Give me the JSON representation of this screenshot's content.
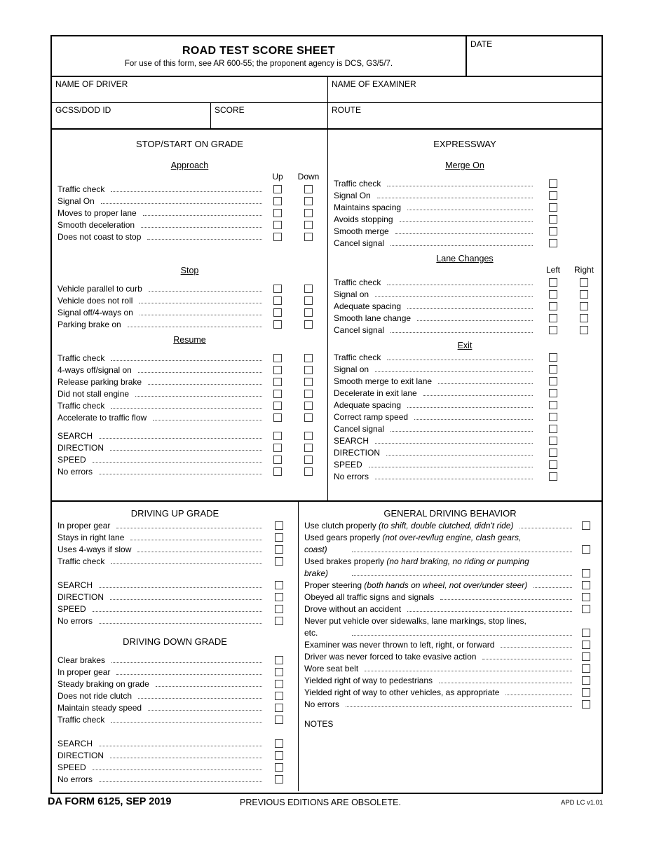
{
  "header": {
    "title": "ROAD TEST SCORE SHEET",
    "subtitle": "For use of this form, see AR 600-55; the proponent agency is DCS, G3/5/7.",
    "date_label": "DATE",
    "name_of_driver_label": "NAME OF DRIVER",
    "name_of_examiner_label": "NAME OF EXAMINER",
    "gcss_dod_id_label": "GCSS/DOD ID",
    "score_label": "SCORE",
    "route_label": "ROUTE"
  },
  "stop_start_on_grade": {
    "heading": "STOP/START ON GRADE",
    "col_up": "Up",
    "col_down": "Down",
    "approach": {
      "heading": "Approach",
      "items": [
        "Traffic check",
        "Signal On",
        "Moves to proper lane",
        "Smooth deceleration",
        "Does not coast to stop"
      ]
    },
    "stop": {
      "heading": "Stop",
      "items": [
        "Vehicle parallel to curb",
        "Vehicle does not roll",
        "Signal off/4-ways on",
        "Parking brake on"
      ]
    },
    "resume": {
      "heading": "Resume",
      "items": [
        "Traffic check",
        "4-ways off/signal on",
        "Release parking brake",
        "Did not stall engine",
        "Traffic check",
        "Accelerate to traffic flow"
      ],
      "summary": [
        "SEARCH",
        "DIRECTION",
        "SPEED",
        "No errors"
      ]
    }
  },
  "expressway": {
    "heading": "EXPRESSWAY",
    "col_left": "Left",
    "col_right": "Right",
    "merge_on": {
      "heading": "Merge On",
      "items": [
        "Traffic check",
        "Signal On",
        "Maintains spacing",
        "Avoids stopping",
        "Smooth merge",
        "Cancel signal"
      ]
    },
    "lane_changes": {
      "heading": "Lane Changes",
      "items": [
        "Traffic check",
        "Signal on",
        "Adequate spacing",
        "Smooth lane change",
        "Cancel signal"
      ]
    },
    "exit": {
      "heading": "Exit",
      "items": [
        "Traffic check",
        "Signal on",
        "Smooth merge to exit lane",
        "Decelerate in exit lane",
        "Adequate spacing",
        "Correct ramp speed",
        "Cancel signal",
        "SEARCH",
        "DIRECTION",
        "SPEED",
        "No errors"
      ]
    }
  },
  "driving_up_grade": {
    "heading": "DRIVING UP GRADE",
    "items": [
      "In proper gear",
      "Stays in right lane",
      "Uses 4-ways if slow",
      "Traffic check"
    ],
    "summary": [
      "SEARCH",
      "DIRECTION",
      "SPEED",
      "No errors"
    ]
  },
  "driving_down_grade": {
    "heading": "DRIVING DOWN GRADE",
    "items": [
      "Clear brakes",
      "In proper gear",
      "Steady braking on grade",
      "Does not ride clutch",
      "Maintain steady speed",
      "Traffic check"
    ],
    "summary": [
      "SEARCH",
      "DIRECTION",
      "SPEED",
      "No errors"
    ]
  },
  "general_driving_behavior": {
    "heading": "GENERAL DRIVING BEHAVIOR",
    "items": [
      {
        "main": "Use clutch properly ",
        "note": "(to shift, double clutched, didn't ride)"
      },
      {
        "main": "Used gears properly ",
        "note": "(not over-rev/lug engine, clash gears, coast)"
      },
      {
        "main": "Used brakes properly ",
        "note": "(no hard braking, no riding or pumping brake)"
      },
      {
        "main": "Proper steering ",
        "note": "(both hands on wheel, not over/under steer)"
      },
      {
        "main": "Obeyed all traffic signs and signals",
        "note": ""
      },
      {
        "main": "Drove without an accident",
        "note": ""
      },
      {
        "main": "Never put vehicle over sidewalks, lane markings, stop lines, etc.",
        "note": ""
      },
      {
        "main": "Examiner was never thrown to left, right, or forward",
        "note": ""
      },
      {
        "main": "Driver was never forced to take evasive action",
        "note": ""
      },
      {
        "main": "Wore seat belt",
        "note": ""
      },
      {
        "main": "Yielded right of way to pedestrians",
        "note": ""
      },
      {
        "main": "Yielded right of way to other vehicles, as appropriate",
        "note": ""
      },
      {
        "main": "No errors",
        "note": ""
      }
    ],
    "notes_label": "NOTES"
  },
  "footer": {
    "form_number": "DA FORM 6125, SEP 2019",
    "previous_editions": "PREVIOUS EDITIONS ARE OBSOLETE.",
    "apd": "APD LC v1.01"
  }
}
